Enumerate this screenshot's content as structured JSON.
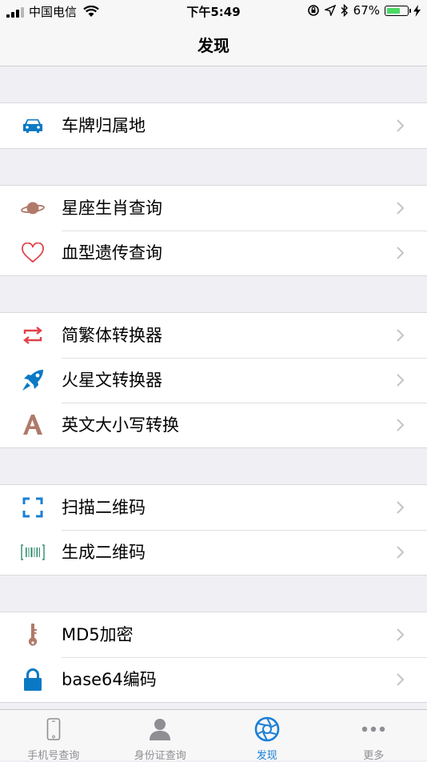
{
  "status_bar": {
    "carrier": "中国电信",
    "time": "下午5:49",
    "battery_percent": "67%",
    "battery_level": 0.67
  },
  "nav": {
    "title": "发现"
  },
  "groups": [
    {
      "items": [
        {
          "label": "车牌归属地",
          "icon": "car-icon"
        }
      ]
    },
    {
      "items": [
        {
          "label": "星座生肖查询",
          "icon": "planet-icon"
        },
        {
          "label": "血型遗传查询",
          "icon": "heart-icon"
        }
      ]
    },
    {
      "items": [
        {
          "label": "简繁体转换器",
          "icon": "swap-arrows-icon"
        },
        {
          "label": "火星文转换器",
          "icon": "rocket-icon"
        },
        {
          "label": "英文大小写转换",
          "icon": "letter-a-icon"
        }
      ]
    },
    {
      "items": [
        {
          "label": "扫描二维码",
          "icon": "scan-frame-icon"
        },
        {
          "label": "生成二维码",
          "icon": "barcode-icon"
        }
      ]
    },
    {
      "items": [
        {
          "label": "MD5加密",
          "icon": "key-icon"
        },
        {
          "label": "base64编码",
          "icon": "lock-icon"
        }
      ]
    }
  ],
  "tabs": [
    {
      "label": "手机号查询",
      "icon": "phone-icon"
    },
    {
      "label": "身份证查询",
      "icon": "person-icon"
    },
    {
      "label": "发现",
      "icon": "aperture-icon",
      "active": true
    },
    {
      "label": "更多",
      "icon": "more-dots-icon"
    }
  ],
  "colors": {
    "accent": "#1a7fd6",
    "car": "#0a79c4",
    "planet": "#b07a6a",
    "heart": "#e0424a",
    "swap": "#e0424a",
    "rocket": "#0a79c4",
    "letter": "#b07a6a",
    "scan": "#1a7fd6",
    "barcode": "#2e8b6e",
    "key": "#b07a6a",
    "lock": "#0a79c4"
  }
}
